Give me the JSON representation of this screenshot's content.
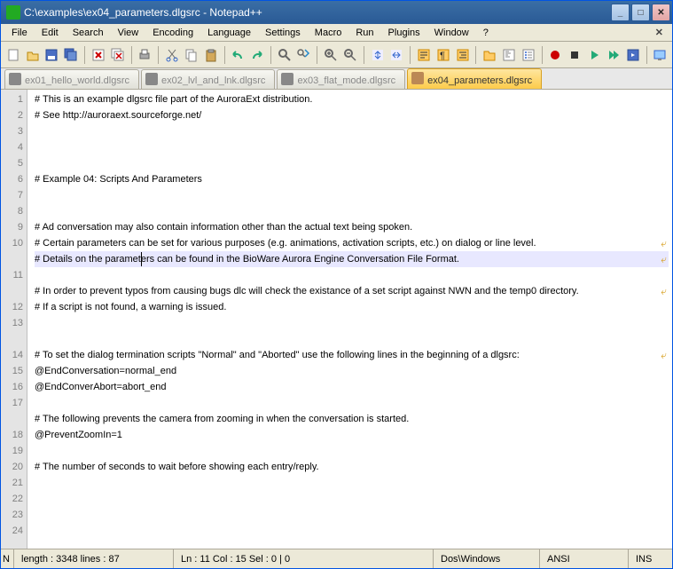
{
  "window": {
    "title": "C:\\examples\\ex04_parameters.dlgsrc - Notepad++"
  },
  "menu": [
    "File",
    "Edit",
    "Search",
    "View",
    "Encoding",
    "Language",
    "Settings",
    "Macro",
    "Run",
    "Plugins",
    "Window",
    "?"
  ],
  "tabs": [
    {
      "label": "ex01_hello_world.dlgsrc",
      "active": false
    },
    {
      "label": "ex02_lvl_and_lnk.dlgsrc",
      "active": false
    },
    {
      "label": "ex03_flat_mode.dlgsrc",
      "active": false
    },
    {
      "label": "ex04_parameters.dlgsrc",
      "active": true
    }
  ],
  "lines": [
    "# This is an example dlgsrc file part of the AuroraExt distribution.",
    "# See http://auroraext.sourceforge.net/",
    "",
    "",
    "",
    "# Example 04: Scripts And Parameters",
    "",
    "",
    "# Ad conversation may also contain information other than the actual text being spoken.",
    "# Certain parameters can be set for various purposes (e.g. animations, activation scripts, etc.) on dialog or line level.",
    "# Details on the parameters can be found in the BioWare Aurora Engine Conversation File Format.",
    "",
    "# In order to prevent typos from causing bugs dlc will check the existance of a set script against NWN and the temp0 directory.",
    "# If a script is not found, a warning is issued.",
    "",
    "",
    "# To set the dialog termination scripts \"Normal\" and \"Aborted\" use the following lines in the beginning of a dlgsrc:",
    "@EndConversation=normal_end",
    "@EndConverAbort=abort_end",
    "",
    "# The following prevents the camera from zooming in when the conversation is started.",
    "@PreventZoomIn=1",
    "",
    "# The number of seconds to wait before showing each entry/reply."
  ],
  "highlight_line": 11,
  "status": {
    "norm": "N",
    "length": "length : 3348     lines : 87",
    "pos": "Ln : 11    Col : 15    Sel : 0 | 0",
    "eol": "Dos\\Windows",
    "enc": "ANSI",
    "ins": "INS"
  },
  "toolbar_icons": [
    "new",
    "open",
    "save",
    "save-all",
    "sep",
    "close",
    "close-all",
    "sep",
    "print",
    "sep",
    "cut",
    "copy",
    "paste",
    "sep",
    "undo",
    "redo",
    "sep",
    "find",
    "replace",
    "sep",
    "zoom-in",
    "zoom-out",
    "sep",
    "sync-v",
    "sync-h",
    "sep",
    "wordwrap",
    "all-chars",
    "indent",
    "sep",
    "folder",
    "doc-map",
    "func-list",
    "sep",
    "rec",
    "stop",
    "play",
    "play-multi",
    "save-macro",
    "sep",
    "monitor"
  ]
}
